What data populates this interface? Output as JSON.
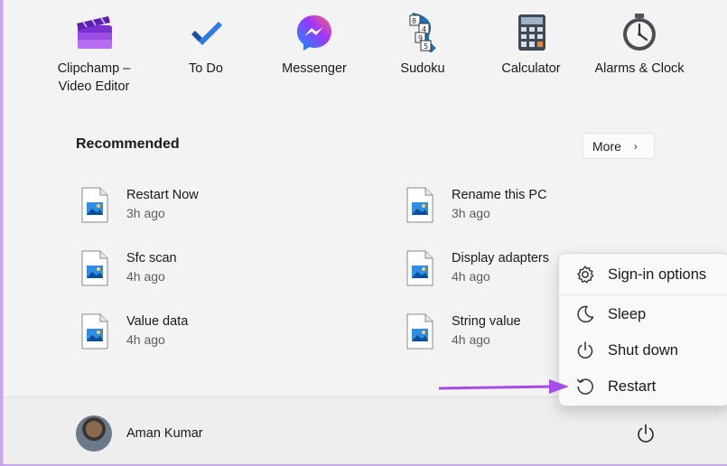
{
  "pinned": [
    {
      "label": "Clipchamp –\nVideo Editor",
      "icon": "clipchamp-icon"
    },
    {
      "label": "To Do",
      "icon": "todo-icon"
    },
    {
      "label": "Messenger",
      "icon": "messenger-icon"
    },
    {
      "label": "Sudoku",
      "icon": "sudoku-icon"
    },
    {
      "label": "Calculator",
      "icon": "calculator-icon"
    },
    {
      "label": "Alarms & Clock",
      "icon": "alarm-clock-icon"
    }
  ],
  "recommended": {
    "title": "Recommended",
    "more_label": "More",
    "items": [
      {
        "name": "Restart Now",
        "time": "3h ago"
      },
      {
        "name": "Rename this PC",
        "time": "3h ago"
      },
      {
        "name": "Sfc scan",
        "time": "4h ago"
      },
      {
        "name": "Display adapters",
        "time": "4h ago"
      },
      {
        "name": "Value data",
        "time": "4h ago"
      },
      {
        "name": "String value",
        "time": "4h ago"
      }
    ]
  },
  "power_menu": {
    "items": [
      {
        "label": "Sign-in options",
        "icon": "gear-icon"
      },
      {
        "label": "Sleep",
        "icon": "moon-icon"
      },
      {
        "label": "Shut down",
        "icon": "power-icon"
      },
      {
        "label": "Restart",
        "icon": "restart-icon"
      }
    ]
  },
  "user": {
    "name": "Aman Kumar"
  },
  "colors": {
    "accent": "#a64ce6",
    "todo_blue": "#2564cf",
    "messenger_start": "#0695ff",
    "messenger_end": "#f53f7a"
  }
}
